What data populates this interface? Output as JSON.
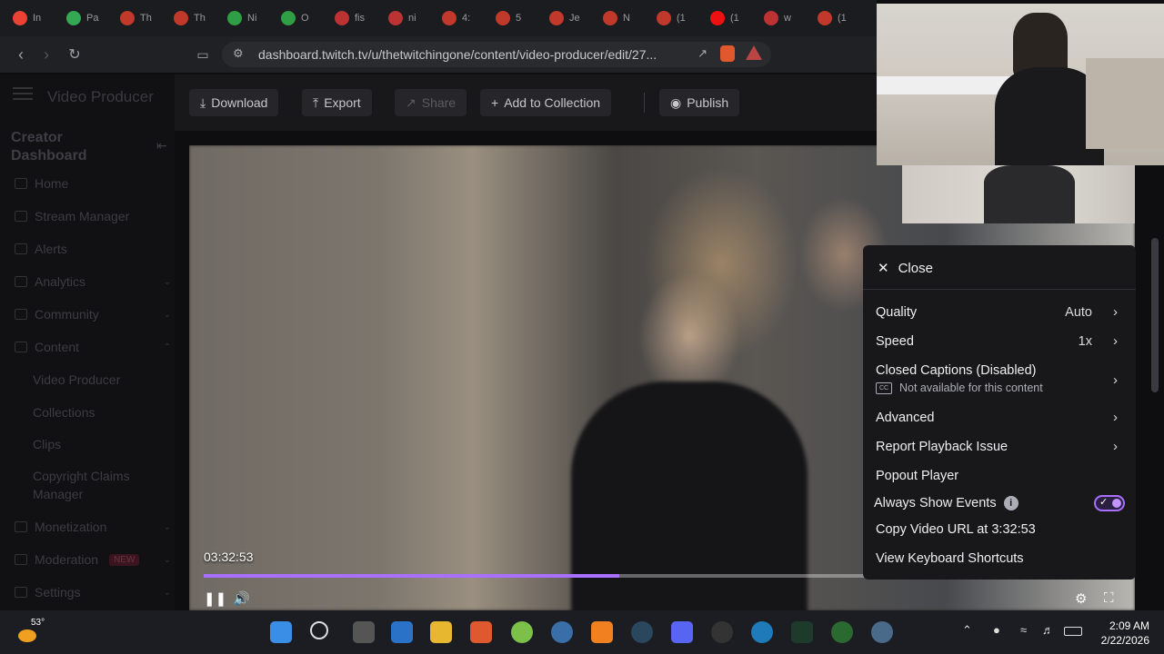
{
  "browser": {
    "tabs": [
      "In",
      "Pa",
      "Th",
      "Th",
      "Ni",
      "O",
      "fis",
      "ni",
      "4:",
      "5",
      "Je",
      "N",
      "(1",
      "(1",
      "w",
      "(1"
    ],
    "url": "dashboard.twitch.tv/u/thetwitchingone/content/video-producer/edit/27..."
  },
  "sidebar": {
    "title": "Video Producer",
    "section": "Creator Dashboard",
    "items": [
      {
        "label": "Home"
      },
      {
        "label": "Stream Manager"
      },
      {
        "label": "Alerts"
      },
      {
        "label": "Analytics"
      },
      {
        "label": "Community"
      },
      {
        "label": "Content"
      }
    ],
    "content_sub": [
      "Video Producer",
      "Collections",
      "Clips",
      "Copyright Claims Manager"
    ],
    "bottom_items": [
      {
        "label": "Monetization"
      },
      {
        "label": "Moderation",
        "badge": "NEW"
      },
      {
        "label": "Settings"
      }
    ]
  },
  "toolbar": {
    "download": "Download",
    "export": "Export",
    "share": "Share",
    "add_collection": "Add to Collection",
    "publish": "Publish"
  },
  "player": {
    "timestamp": "03:32:53",
    "progress": 0.45
  },
  "settings_menu": {
    "close": "Close",
    "quality_label": "Quality",
    "quality_value": "Auto",
    "speed_label": "Speed",
    "speed_value": "1x",
    "captions_label": "Closed Captions (Disabled)",
    "captions_sub": "Not available for this content",
    "advanced": "Advanced",
    "report": "Report Playback Issue",
    "popout": "Popout Player",
    "always_show": "Always Show Events",
    "copy_url": "Copy Video URL at 3:32:53",
    "shortcuts": "View Keyboard Shortcuts"
  },
  "taskbar": {
    "temperature": "53°",
    "time": "2:09 AM",
    "date": "2/22/2026"
  },
  "colors": {
    "accent": "#a970ff"
  }
}
